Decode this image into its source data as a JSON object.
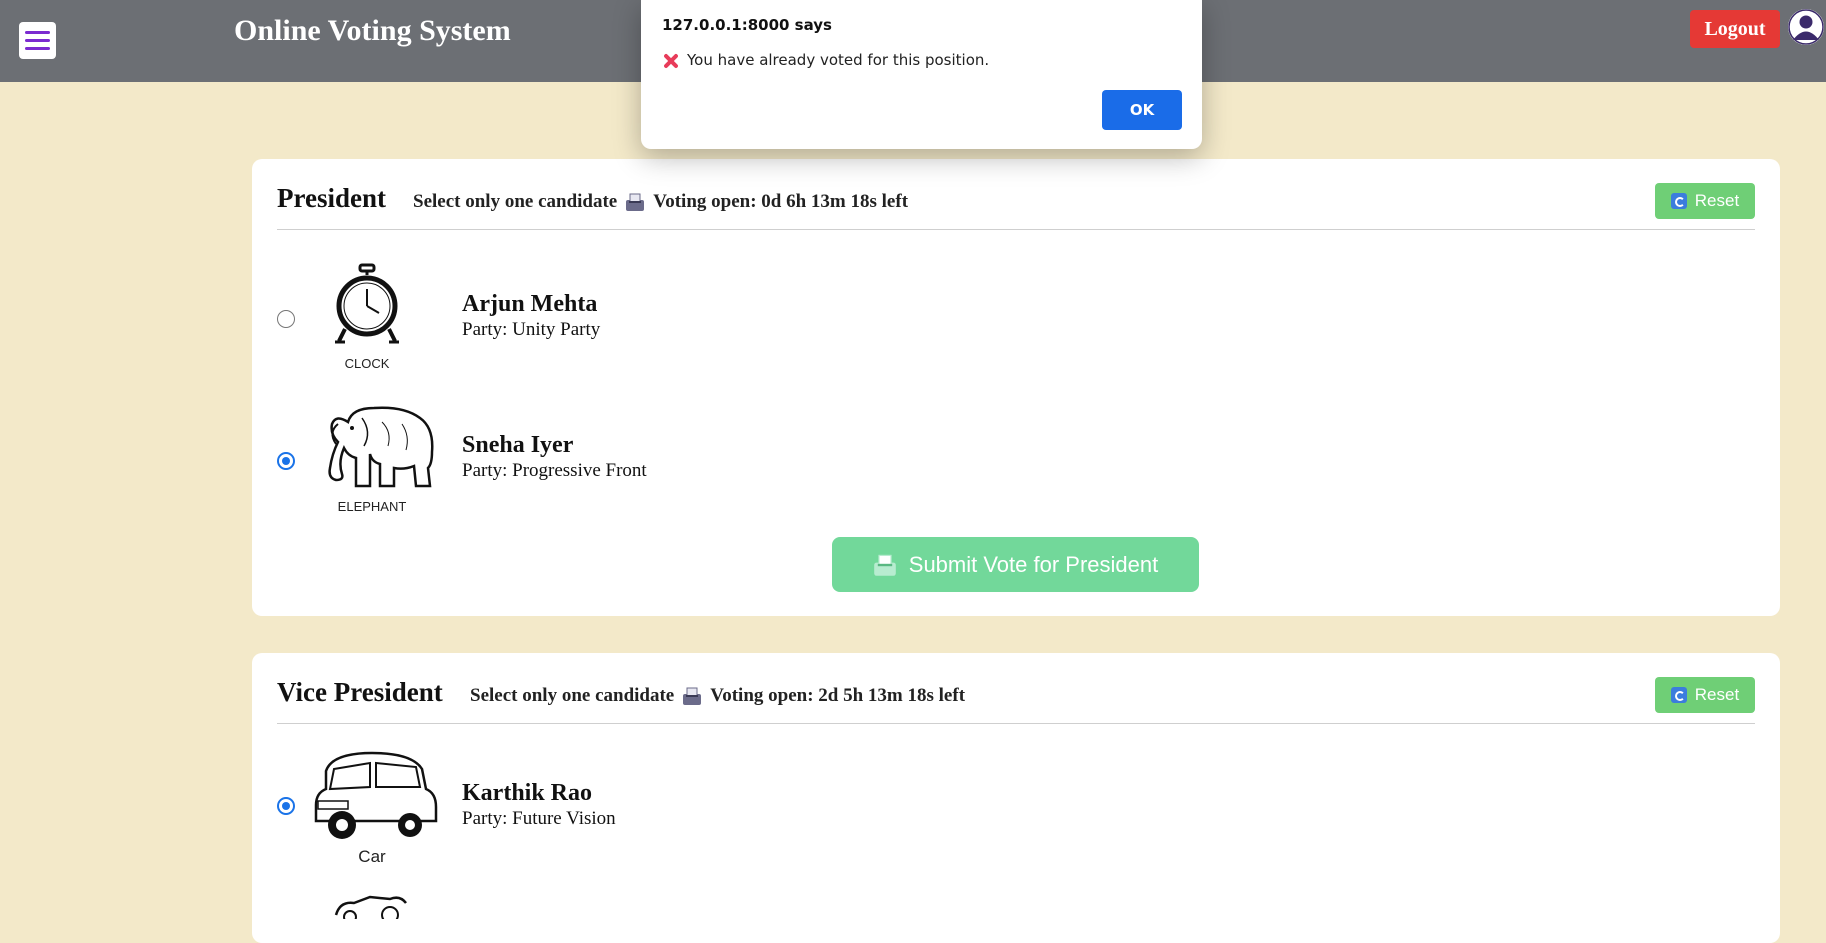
{
  "header": {
    "title": "Online Voting System",
    "logout_label": "Logout"
  },
  "dialog": {
    "title": "127.0.0.1:8000 says",
    "message": "You have already voted for this position.",
    "ok_label": "OK"
  },
  "positions": [
    {
      "title": "President",
      "instruction": "Select only one candidate",
      "timer": "Voting open: 0d 6h 13m 18s left",
      "reset_label": "Reset",
      "submit_label": "Submit Vote for President",
      "candidates": [
        {
          "name": "Arjun Mehta",
          "party": "Party: Unity Party",
          "symbol": "CLOCK",
          "selected": false
        },
        {
          "name": "Sneha Iyer",
          "party": "Party: Progressive Front",
          "symbol": "ELEPHANT",
          "selected": true
        }
      ]
    },
    {
      "title": "Vice President",
      "instruction": "Select only one candidate",
      "timer": "Voting open: 2d 5h 13m 18s left",
      "reset_label": "Reset",
      "candidates": [
        {
          "name": "Karthik Rao",
          "party": "Party: Future Vision",
          "symbol": "Car",
          "selected": true
        }
      ]
    }
  ],
  "colors": {
    "page_bg": "#f3e9c9",
    "topbar": "#6c6f74",
    "logout": "#e53935",
    "reset": "#6fcf76",
    "submit": "#72d89a",
    "radio_selected": "#1a73e8",
    "ok_button": "#1a6ce8"
  }
}
